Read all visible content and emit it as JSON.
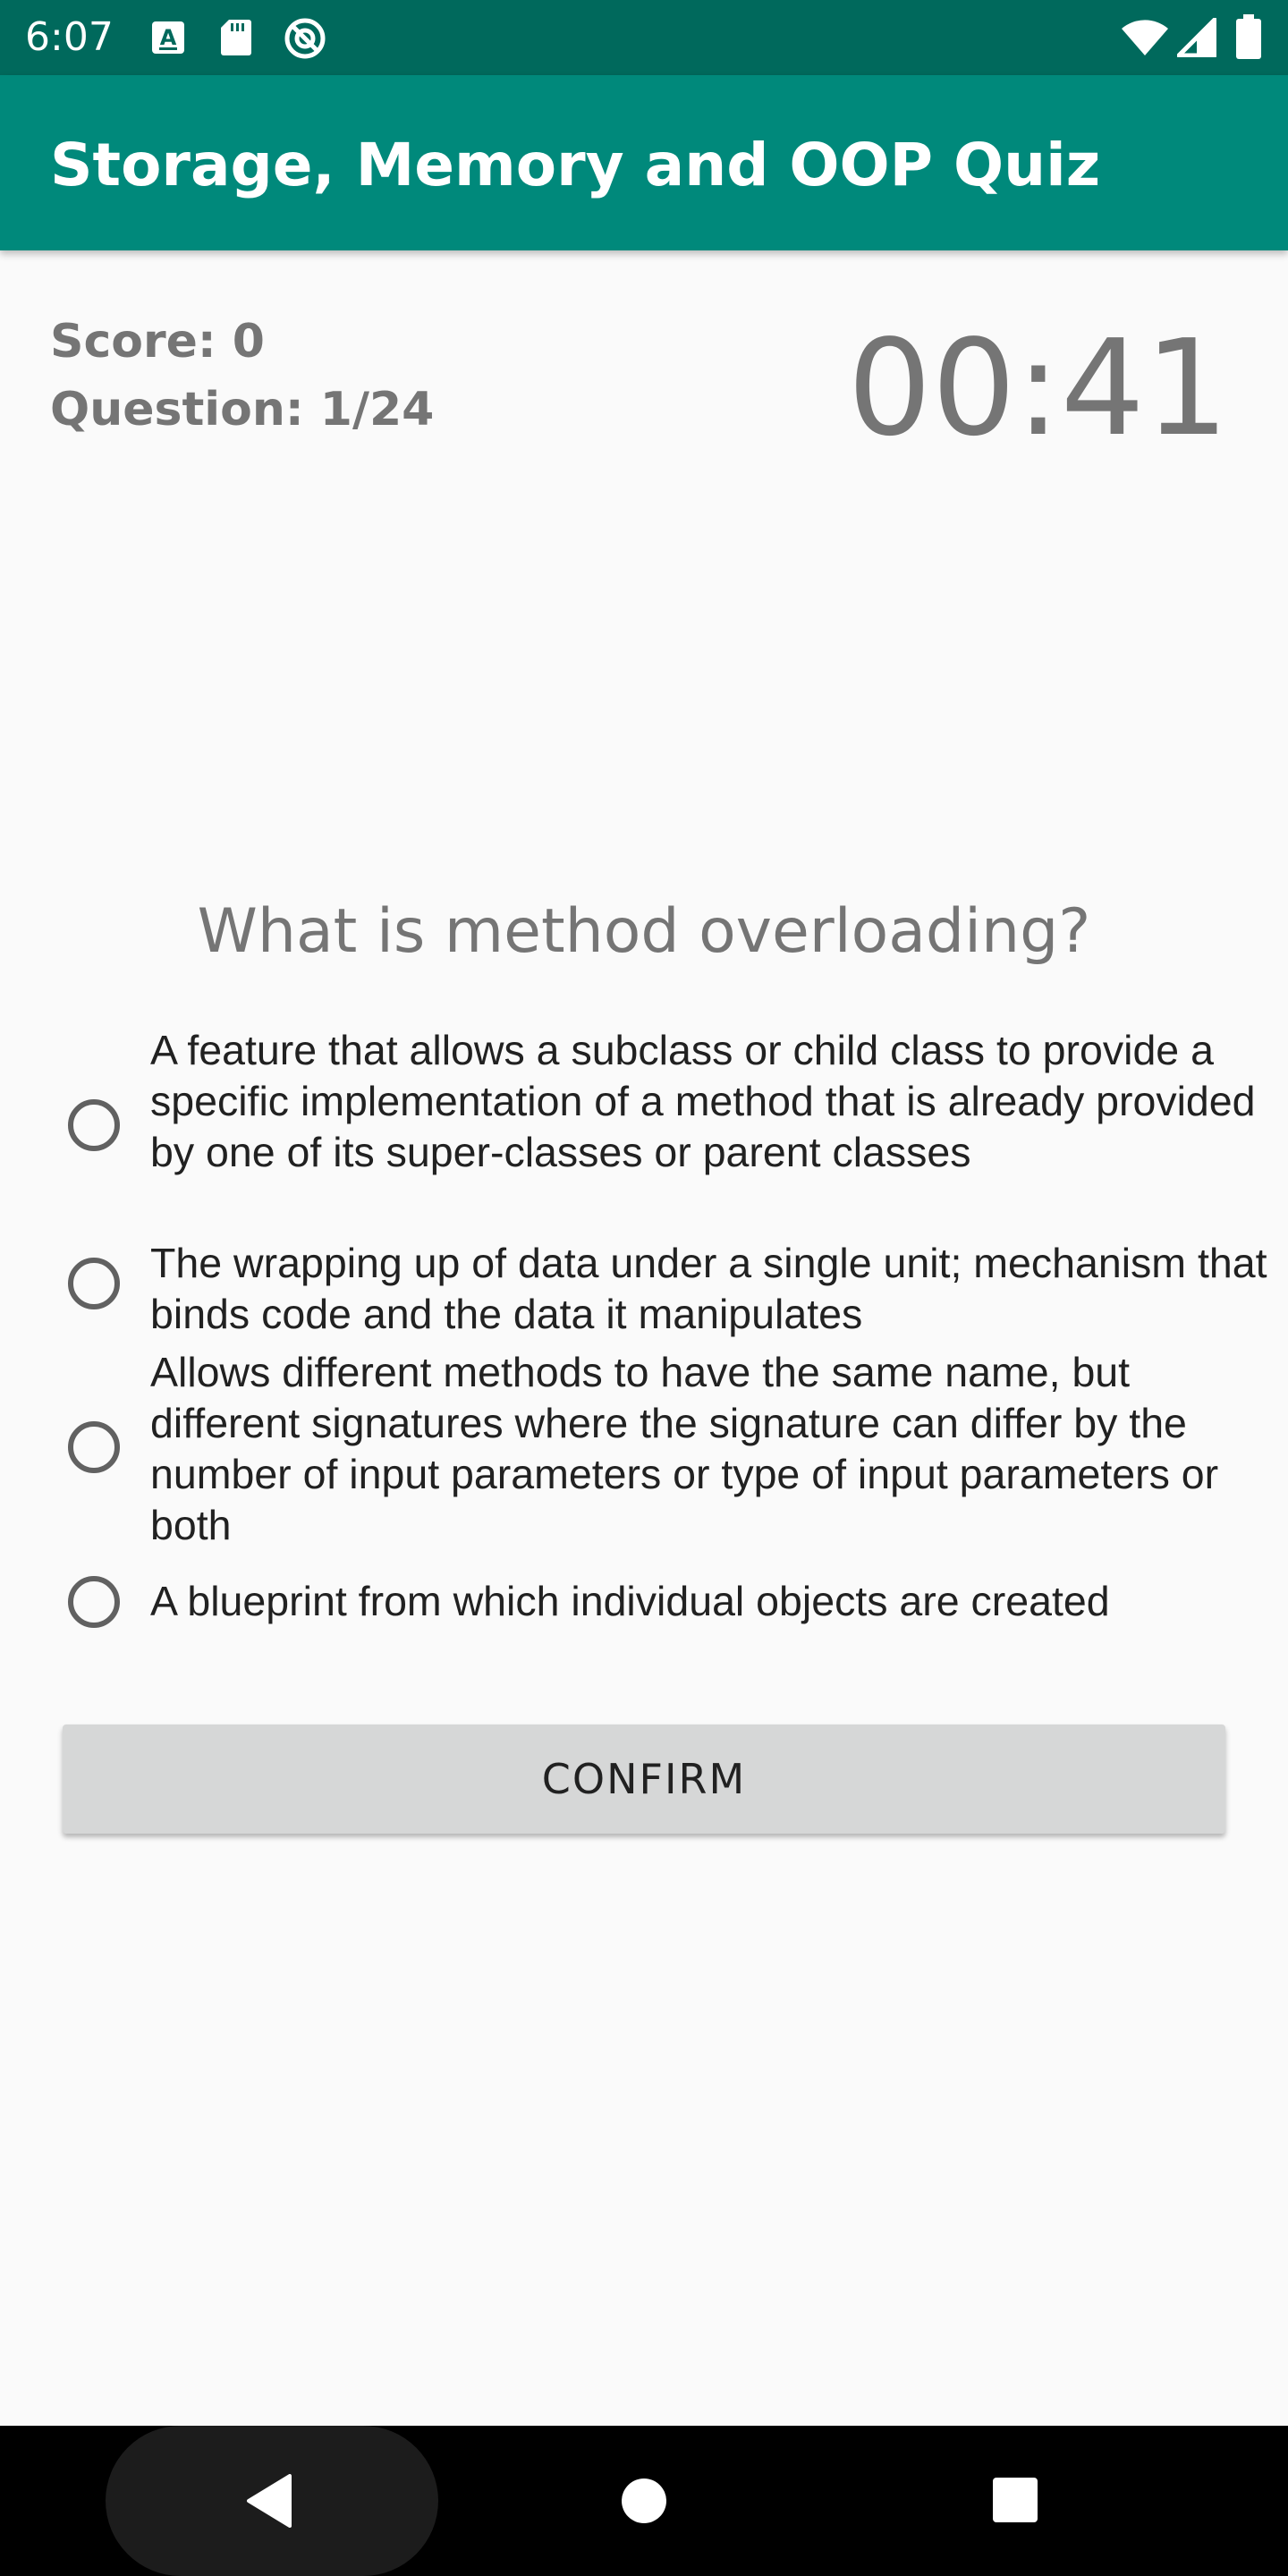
{
  "status_bar": {
    "time": "6:07",
    "left_icons": [
      "a11y-a-icon",
      "sd-card-icon",
      "no-sync-icon"
    ],
    "right_icons": [
      "wifi-icon",
      "cell-signal-icon",
      "battery-icon"
    ],
    "background": "#00695c"
  },
  "app_bar": {
    "title": "Storage, Memory and OOP Quiz",
    "background": "#00897b"
  },
  "quiz": {
    "score_label": "Score: 0",
    "question_counter": "Question: 1/24",
    "timer": "00:41",
    "question": "What is method overloading?",
    "options": [
      {
        "label": "A feature that allows a subclass or child class to provide a specific implementation of a method that is already provided by one of its super-classes or parent classes",
        "selected": false
      },
      {
        "label": "The wrapping up of data under a single unit; mechanism that binds code and the data it manipulates",
        "selected": false
      },
      {
        "label": "Allows different methods to have the same name, but different signatures where the signature can differ by the number of input parameters or type of input parameters or both",
        "selected": false
      },
      {
        "label": "A blueprint from which individual objects are created",
        "selected": false
      }
    ],
    "confirm_label": "CONFIRM"
  },
  "nav_bar": {
    "icons": [
      "back-icon",
      "home-icon",
      "recents-icon"
    ]
  }
}
